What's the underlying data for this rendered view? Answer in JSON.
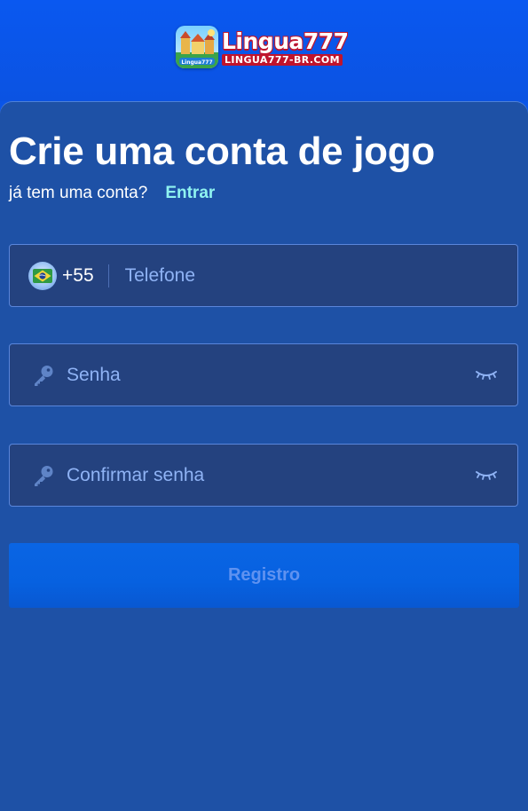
{
  "header": {
    "logo_name": "Lingua777",
    "logo_domain": "LINGUA777-BR.COM",
    "colors": {
      "background": "#0a55e8",
      "logo_red": "#c0142c"
    }
  },
  "register": {
    "title": "Crie uma conta de jogo",
    "have_account": "já tem uma conta?",
    "login_link": "Entrar",
    "phone": {
      "country_code": "+55",
      "flag_icon": "brazil-flag-icon",
      "placeholder": "Telefone",
      "value": ""
    },
    "password": {
      "icon": "key-icon",
      "placeholder": "Senha",
      "value": "",
      "toggle_icon": "eye-closed-icon"
    },
    "confirm_password": {
      "icon": "key-icon",
      "placeholder": "Confirmar senha",
      "value": "",
      "toggle_icon": "eye-closed-icon"
    },
    "submit_label": "Registro",
    "colors": {
      "panel": "#1e51a6",
      "field_bg": "#24427f",
      "field_border": "#5a86db",
      "link": "#8ff3f0",
      "button": "#0a65e4",
      "button_text": "#5f92f0"
    }
  }
}
